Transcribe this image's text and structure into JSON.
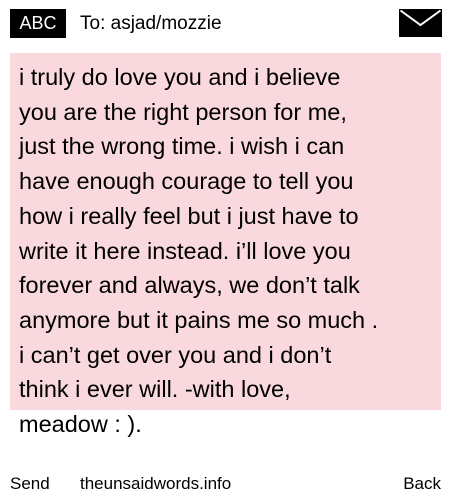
{
  "header": {
    "input_mode": "ABC",
    "recipient": "To: asjad/mozzie",
    "envelope_icon": "envelope-icon"
  },
  "message": {
    "text": "i truly do love you and i believe\nyou are the right person for me,\njust the wrong time. i wish i can\nhave enough courage to tell you\nhow i really feel but i just have to\nwrite it here instead. i’ll love you\nforever and always, we don’t talk\nanymore but it pains me so much .\ni can’t get over you and i don’t\nthink i ever will. -with love,\nmeadow : ).",
    "highlight_color": "#f9d9de"
  },
  "softkeys": {
    "left": "Send",
    "center": "theunsaidwords.info",
    "right": "Back"
  }
}
